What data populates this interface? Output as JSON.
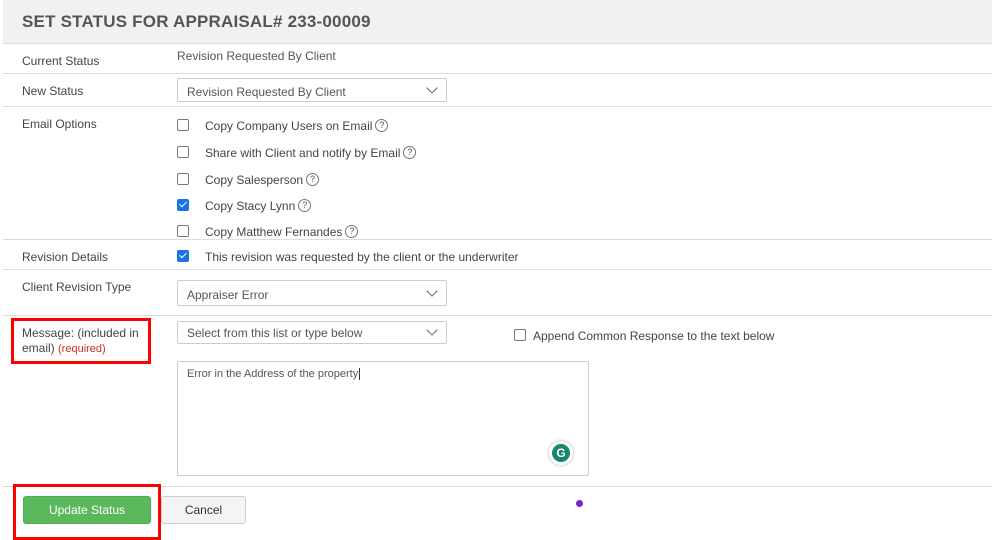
{
  "dialog": {
    "title": "SET STATUS FOR APPRAISAL# 233-00009"
  },
  "current_status": {
    "label": "Current Status",
    "value": "Revision Requested By Client"
  },
  "new_status": {
    "label": "New Status",
    "value": "Revision Requested By Client"
  },
  "email_options": {
    "label": "Email Options",
    "items": [
      {
        "label": "Copy Company Users on Email",
        "checked": false
      },
      {
        "label": "Share with Client and notify by Email",
        "checked": false
      },
      {
        "label": "Copy Salesperson",
        "checked": false
      },
      {
        "label": "Copy Stacy Lynn",
        "checked": true
      },
      {
        "label": "Copy Matthew Fernandes",
        "checked": false
      }
    ],
    "help_glyph": "?"
  },
  "revision_details": {
    "label": "Revision Details",
    "option": "This revision was requested by the client or the underwriter",
    "checked": true
  },
  "client_revision_type": {
    "label": "Client Revision Type",
    "value": "Appraiser Error"
  },
  "message": {
    "label": "Message: (included in email)",
    "required": "(required)",
    "select_placeholder": "Select from this list or type below",
    "append_label": "Append Common Response to the text below",
    "append_checked": false,
    "text": "Error in the Address of the property"
  },
  "buttons": {
    "update": "Update Status",
    "cancel": "Cancel"
  },
  "colors": {
    "update_button": "#5cb85c",
    "highlight": "#ff0000",
    "checkbox": "#1a73e8"
  }
}
